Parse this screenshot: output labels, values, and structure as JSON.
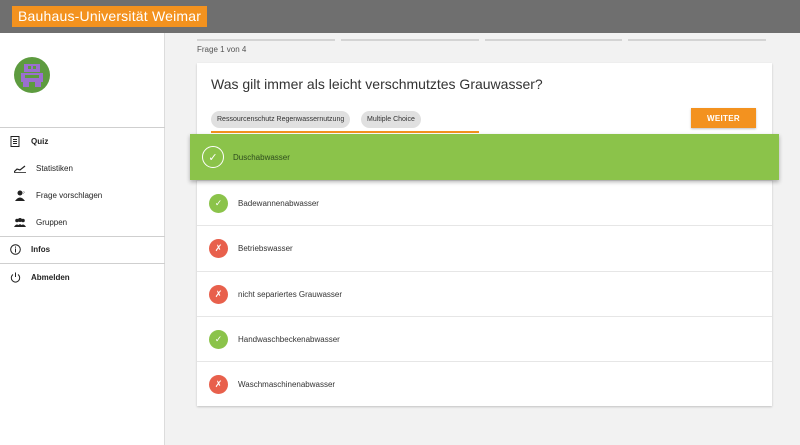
{
  "brand": {
    "title": "Bauhaus-Universität Weimar",
    "color": "#f3921f"
  },
  "sidebar": {
    "items": [
      {
        "label": "Quiz",
        "icon": "quiz-icon"
      },
      {
        "label": "Statistiken",
        "icon": "chart-icon"
      },
      {
        "label": "Frage vorschlagen",
        "icon": "suggest-icon"
      },
      {
        "label": "Gruppen",
        "icon": "group-icon"
      },
      {
        "label": "Infos",
        "icon": "info-icon"
      },
      {
        "label": "Abmelden",
        "icon": "power-icon"
      }
    ]
  },
  "progress": {
    "label": "Frage 1 von 4"
  },
  "question": {
    "text": "Was gilt immer als leicht verschmutztes Grauwasser?",
    "tags": [
      "Ressourcenschutz Regenwassernutzung",
      "Multiple Choice"
    ],
    "next_label": "WEITER"
  },
  "answers": [
    {
      "label": "Duschabwasser",
      "status": "correct",
      "highlighted": true
    },
    {
      "label": "Badewannenabwasser",
      "status": "correct"
    },
    {
      "label": "Betriebswasser",
      "status": "wrong"
    },
    {
      "label": "nicht separiertes Grauwasser",
      "status": "wrong"
    },
    {
      "label": "Handwaschbeckenabwasser",
      "status": "correct"
    },
    {
      "label": "Waschmaschinenabwasser",
      "status": "wrong"
    }
  ],
  "colors": {
    "accent": "#f3921f",
    "correct": "#8bc34a",
    "wrong": "#e8604c"
  }
}
